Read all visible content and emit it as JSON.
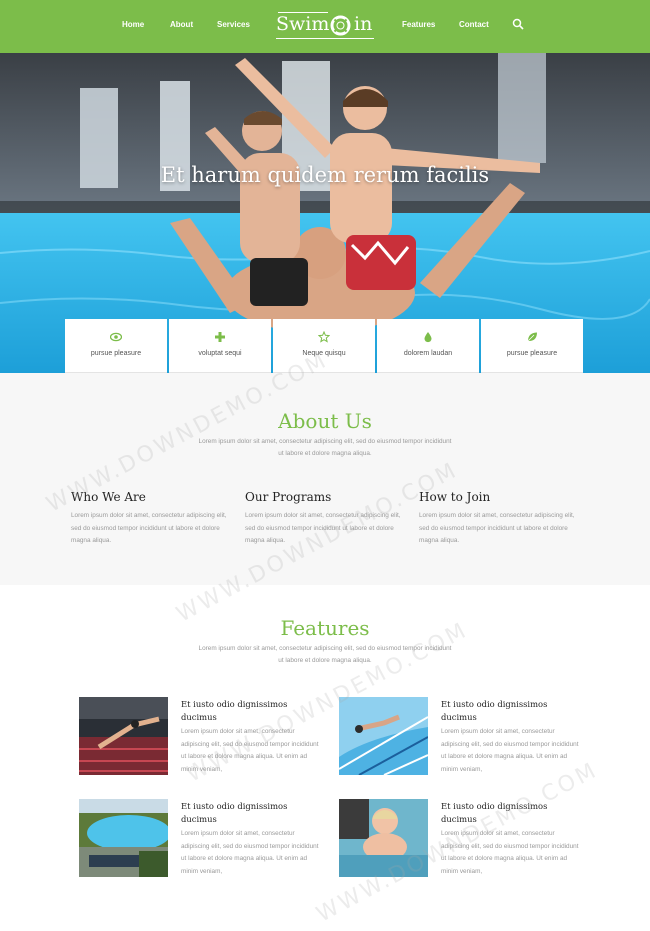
{
  "nav": {
    "links": [
      "Home",
      "About",
      "Services",
      "Features",
      "Contact"
    ],
    "logo": {
      "left": "Swim",
      "right": "in"
    }
  },
  "hero": {
    "title": "Et harum quidem rerum facilis",
    "cards": [
      {
        "icon": "eye-icon",
        "label": "pursue pleasure"
      },
      {
        "icon": "plus-icon",
        "label": "voluptat sequi"
      },
      {
        "icon": "star-icon",
        "label": "Neque quisqu"
      },
      {
        "icon": "drop-icon",
        "label": "dolorem laudan"
      },
      {
        "icon": "leaf-icon",
        "label": "pursue pleasure"
      }
    ]
  },
  "about": {
    "title": "About Us",
    "text": "Lorem ipsum dolor sit amet, consectetur adipiscing elit, sed do eiusmod tempor incididunt ut labore et dolore magna aliqua.",
    "columns": [
      {
        "title": "Who We Are",
        "text": "Lorem ipsum dolor sit amet, consectetur adipiscing elit, sed do eiusmod tempor incididunt ut labore et dolore magna aliqua."
      },
      {
        "title": "Our Programs",
        "text": "Lorem ipsum dolor sit amet, consectetur adipiscing elit, sed do eiusmod tempor incididunt ut labore et dolore magna aliqua."
      },
      {
        "title": "How to Join",
        "text": "Lorem ipsum dolor sit amet, consectetur adipiscing elit, sed do eiusmod tempor incididunt ut labore et dolore magna aliqua."
      }
    ]
  },
  "features": {
    "title": "Features",
    "text": "Lorem ipsum dolor sit amet, consectetur adipiscing elit, sed do eiusmod tempor incididunt ut labore et dolore magna aliqua.",
    "items": [
      {
        "title": "Et iusto odio dignissimos ducimus",
        "text": "Lorem ipsum dolor sit amet, consectetur adipiscing elit, sed do eiusmod tempor incididunt ut labore et dolore magna aliqua. Ut enim ad minim veniam,"
      },
      {
        "title": "Et iusto odio dignissimos ducimus",
        "text": "Lorem ipsum dolor sit amet, consectetur adipiscing elit, sed do eiusmod tempor incididunt ut labore et dolore magna aliqua. Ut enim ad minim veniam,"
      },
      {
        "title": "Et iusto odio dignissimos ducimus",
        "text": "Lorem ipsum dolor sit amet, consectetur adipiscing elit, sed do eiusmod tempor incididunt ut labore et dolore magna aliqua. Ut enim ad minim veniam,"
      },
      {
        "title": "Et iusto odio dignissimos ducimus",
        "text": "Lorem ipsum dolor sit amet, consectetur adipiscing elit, sed do eiusmod tempor incididunt ut labore et dolore magna aliqua. Ut enim ad minim veniam,"
      }
    ]
  },
  "watermark": "WWW.DOWNDEMO.COM",
  "colors": {
    "brand": "#7cbd4a",
    "pool": "#2bb7e8"
  }
}
